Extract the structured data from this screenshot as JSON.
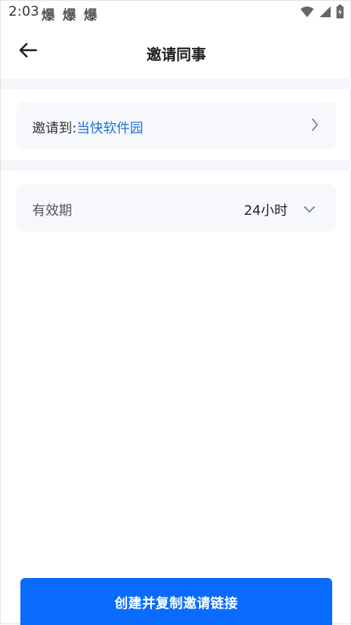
{
  "status_bar": {
    "time": "2:03",
    "notifications": [
      "爆",
      "爆",
      "爆"
    ],
    "icons": [
      "wifi-icon",
      "signal-icon",
      "battery-icon"
    ]
  },
  "header": {
    "title": "邀请同事",
    "back_icon": "arrow-left-icon"
  },
  "invite": {
    "prefix": "邀请到:",
    "target": "当快软件园",
    "chevron_icon": "chevron-right-icon"
  },
  "expiry": {
    "label": "有效期",
    "value": "24小时",
    "chevron_icon": "chevron-down-icon"
  },
  "footer": {
    "primary_button": "创建并复制邀请链接"
  },
  "colors": {
    "accent": "#0a6cff",
    "link": "#1f6fde",
    "card_bg": "#f6f8fb",
    "divider": "#f4f6f9"
  }
}
